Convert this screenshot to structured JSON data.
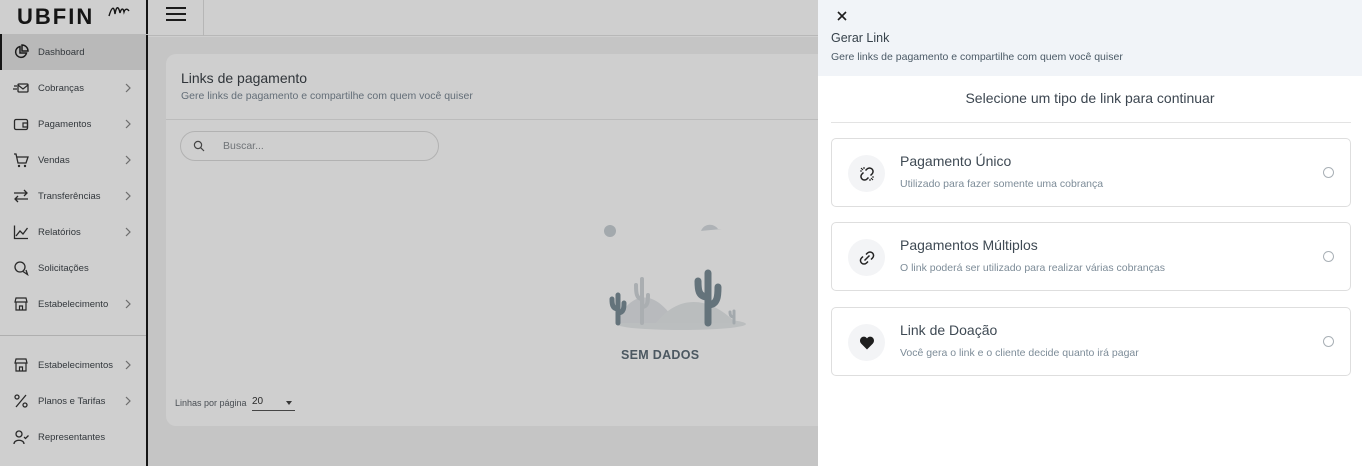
{
  "app": {
    "logo_text": "UBFIN"
  },
  "sidebar": {
    "items": [
      {
        "label": "Dashboard",
        "icon": "pie-chart-icon"
      },
      {
        "label": "Cobranças",
        "icon": "envelope-send-icon"
      },
      {
        "label": "Pagamentos",
        "icon": "wallet-icon"
      },
      {
        "label": "Vendas",
        "icon": "cart-icon"
      },
      {
        "label": "Transferências",
        "icon": "transfer-arrows-icon"
      },
      {
        "label": "Relatórios",
        "icon": "line-chart-icon"
      },
      {
        "label": "Solicitações",
        "icon": "chat-bubbles-icon"
      },
      {
        "label": "Estabelecimento",
        "icon": "store-icon"
      }
    ],
    "admin_items": [
      {
        "label": "Estabelecimentos",
        "icon": "store-icon"
      },
      {
        "label": "Planos e Tarifas",
        "icon": "percent-icon"
      },
      {
        "label": "Representantes",
        "icon": "user-check-icon"
      }
    ]
  },
  "main": {
    "title": "Links de pagamento",
    "subtitle": "Gere links de pagamento e compartilhe com quem você quiser",
    "search_placeholder": "Buscar...",
    "empty_label": "SEM DADOS",
    "rows_per_page_label": "Linhas por página",
    "rows_per_page_value": "20"
  },
  "drawer": {
    "title": "Gerar Link",
    "subtitle": "Gere links de pagamento e compartilhe com quem você quiser",
    "prompt": "Selecione um tipo de link para continuar",
    "options": [
      {
        "title": "Pagamento Único",
        "description": "Utilizado para fazer somente uma cobrança",
        "icon": "broken-link-icon",
        "selected": false
      },
      {
        "title": "Pagamentos Múltiplos",
        "description": "O link poderá ser utilizado para realizar várias cobranças",
        "icon": "link-icon",
        "selected": false
      },
      {
        "title": "Link de Doação",
        "description": "Você gera o link e o cliente decide quanto irá pagar",
        "icon": "heart-icon",
        "selected": false
      }
    ]
  },
  "colors": {
    "overlay": "rgba(0,0,0,0.19)",
    "drawer_header_bg": "#f1f4f8",
    "sidebar_border": "#1a1a1a",
    "empty_text": "#5e6d78"
  }
}
